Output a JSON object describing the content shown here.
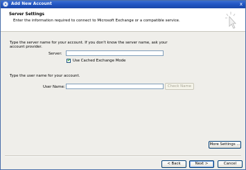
{
  "window": {
    "title": "Add New Account",
    "close_glyph": "x",
    "app_icon": "account-wizard-icon"
  },
  "header": {
    "title": "Server Settings",
    "description": "Enter the information required to connect to Microsoft Exchange or a compatible service.",
    "icon": "wizard-cursor-icon"
  },
  "server_section": {
    "instruction_line1": "Type the server name for your account. If you don't know the server name, ask your",
    "instruction_line2": "account provider.",
    "server_label": "Server:",
    "server_value": "",
    "cached_mode_label": "Use Cached Exchange Mode",
    "cached_mode_checked": true
  },
  "user_section": {
    "instruction": "Type the user name for your account.",
    "username_label": "User Name:",
    "username_value": "",
    "check_name_label": "Check Name"
  },
  "buttons": {
    "more_settings": "More Settings ...",
    "back": "< Back",
    "next": "Next >",
    "cancel": "Cancel"
  }
}
